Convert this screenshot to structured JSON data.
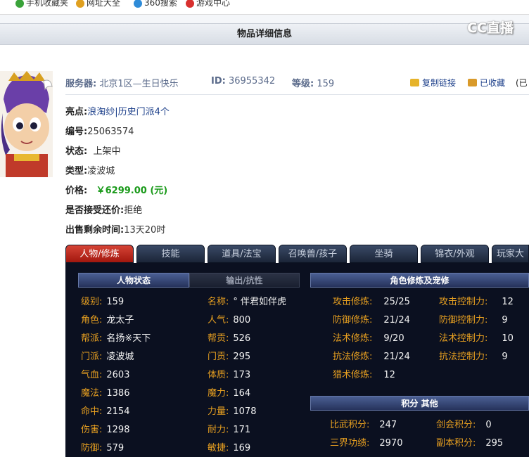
{
  "bookmarks": [
    {
      "label": "手机收藏夹",
      "icon": "phone-icon",
      "color": "#3aa33a"
    },
    {
      "label": "网址大全",
      "icon": "plus-icon",
      "color": "#e0a020"
    },
    {
      "label": "360搜索",
      "icon": "search-icon",
      "color": "#2e8bd8"
    },
    {
      "label": "游戏中心",
      "icon": "game-icon",
      "color": "#d8302e"
    }
  ],
  "page": {
    "title": "物品详细信息",
    "watermark": "CC直播"
  },
  "header": {
    "server_label": "服务器:",
    "server_value": "北京1区—生日快乐",
    "id_label": "ID:",
    "id_value": "36955342",
    "level_label": "等级:",
    "level_value": "159",
    "copy_link": "复制链接",
    "favorited": "已收藏",
    "more": "(已"
  },
  "details": [
    {
      "label": "亮点:",
      "value": "浪淘纱|历史门派4个",
      "style": "link"
    },
    {
      "label": "编号:",
      "value": "25063574",
      "style": "plain"
    },
    {
      "label": "状态:",
      "value": "上架中",
      "style": "plain"
    },
    {
      "label": "类型:",
      "value": "凌波城",
      "style": "plain"
    },
    {
      "label": "价格:",
      "value": "￥6299.00 (元)",
      "style": "price"
    },
    {
      "label": "是否接受还价:",
      "value": "拒绝",
      "style": "plain"
    },
    {
      "label": "出售剩余时间:",
      "value": "13天20时",
      "style": "plain"
    }
  ],
  "tabs": [
    "人物/修炼",
    "技能",
    "道具/法宝",
    "召唤兽/孩子",
    "坐骑",
    "锦衣/外观",
    "玩家大"
  ],
  "panel": {
    "char_status": "人物状态",
    "out_resist": "输出/抗性",
    "cultivation": "角色修炼及宠修",
    "points": "积分  其他",
    "left_col": [
      {
        "k": "级别:",
        "v": "159"
      },
      {
        "k": "角色:",
        "v": "龙太子"
      },
      {
        "k": "帮派:",
        "v": "名扬※天下"
      },
      {
        "k": "门派:",
        "v": "凌波城"
      },
      {
        "k": "气血:",
        "v": "2603"
      },
      {
        "k": "魔法:",
        "v": "1386"
      },
      {
        "k": "命中:",
        "v": "2154"
      },
      {
        "k": "伤害:",
        "v": "1298"
      },
      {
        "k": "防御:",
        "v": "579"
      }
    ],
    "mid_col": [
      {
        "k": "名称:",
        "v": "° 伴君如伴虎"
      },
      {
        "k": "人气:",
        "v": "800"
      },
      {
        "k": "帮贡:",
        "v": "526"
      },
      {
        "k": "门贡:",
        "v": "295"
      },
      {
        "k": "体质:",
        "v": "173"
      },
      {
        "k": "魔力:",
        "v": "164"
      },
      {
        "k": "力量:",
        "v": "1078"
      },
      {
        "k": "耐力:",
        "v": "171"
      },
      {
        "k": "敏捷:",
        "v": "169"
      }
    ],
    "cult_left": [
      {
        "k": "攻击修炼:",
        "v": "25/25"
      },
      {
        "k": "防御修炼:",
        "v": "21/24"
      },
      {
        "k": "法术修炼:",
        "v": "9/20"
      },
      {
        "k": "抗法修炼:",
        "v": "21/24"
      },
      {
        "k": "猎术修炼:",
        "v": "12"
      }
    ],
    "cult_right": [
      {
        "k": "攻击控制力:",
        "v": "12"
      },
      {
        "k": "防御控制力:",
        "v": "9"
      },
      {
        "k": "法术控制力:",
        "v": "10"
      },
      {
        "k": "抗法控制力:",
        "v": "9"
      }
    ],
    "points_left": [
      {
        "k": "比武积分:",
        "v": "247"
      },
      {
        "k": "三界功绩:",
        "v": "2970"
      }
    ],
    "points_right": [
      {
        "k": "剑会积分:",
        "v": "0"
      },
      {
        "k": "副本积分:",
        "v": "295"
      }
    ]
  }
}
